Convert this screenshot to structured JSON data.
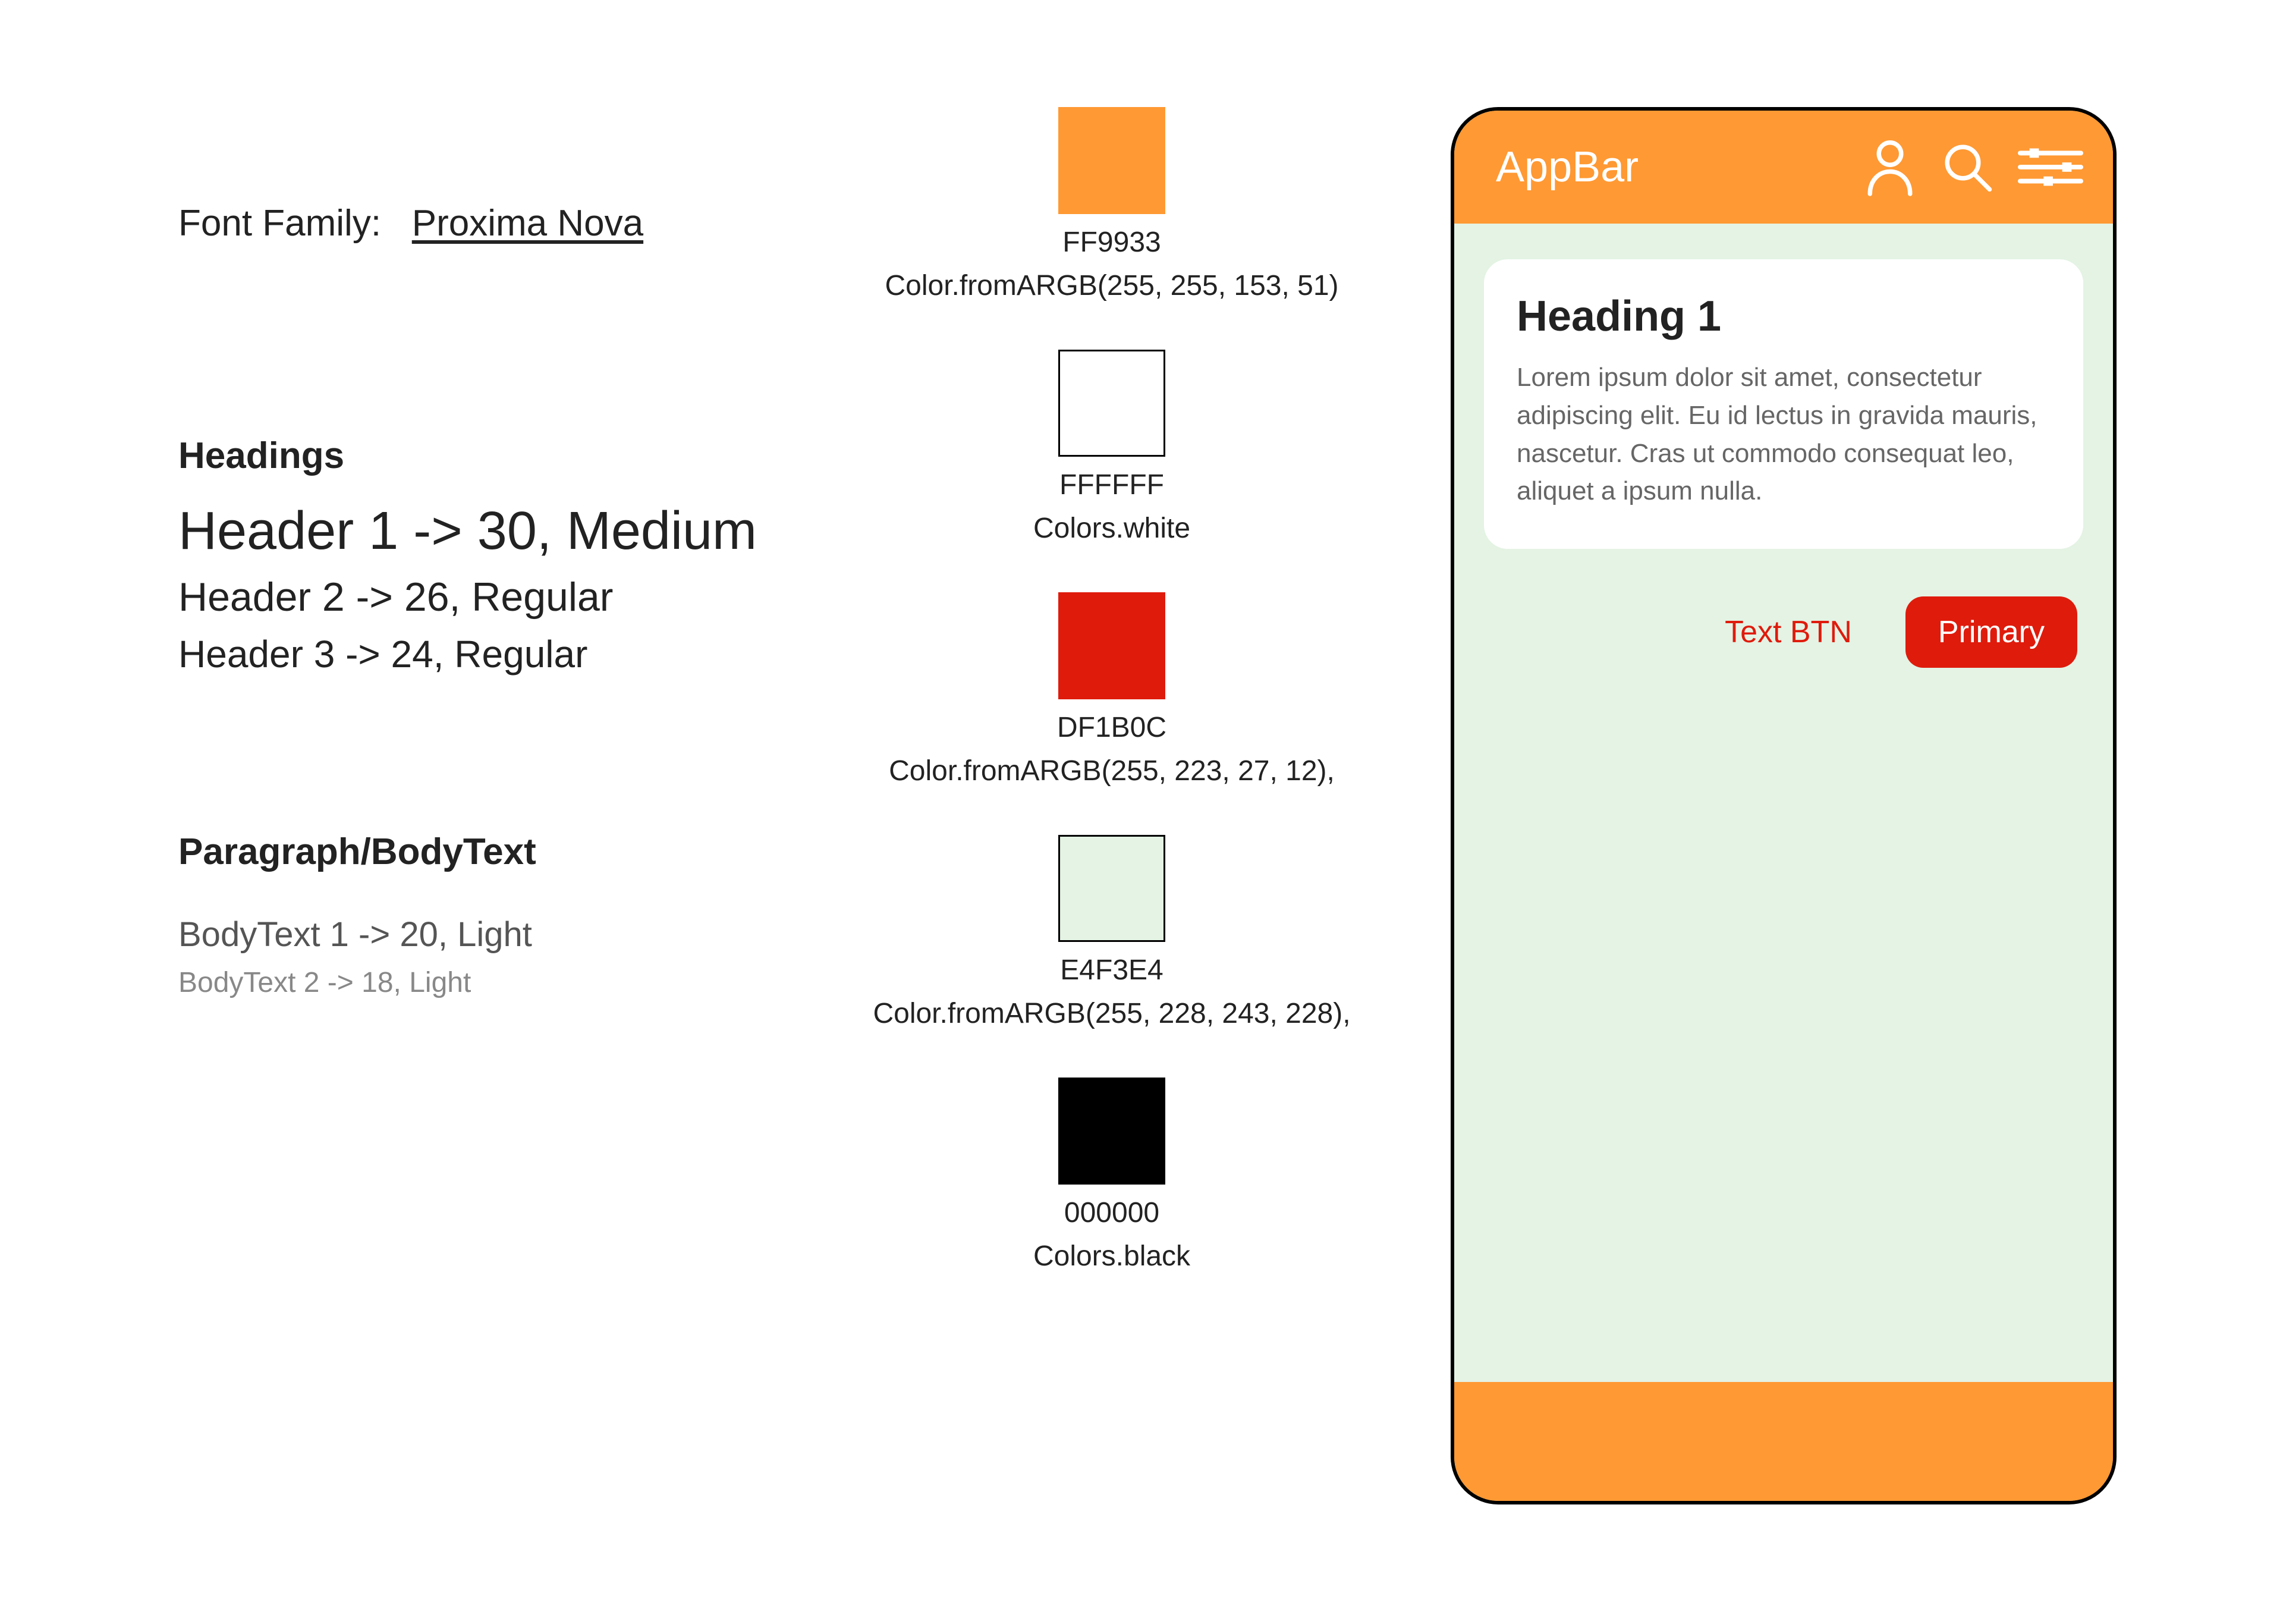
{
  "typography": {
    "font_family_label": "Font Family:",
    "font_family_value": "Proxima Nova",
    "headings_section_title": "Headings",
    "header1_spec": "Header 1 -> 30, Medium",
    "header2_spec": "Header 2 -> 26, Regular",
    "header3_spec": "Header 3 -> 24, Regular",
    "paragraph_section_title": "Paragraph/BodyText",
    "body1_spec": "BodyText 1 -> 20, Light",
    "body2_spec": "BodyText 2 -> 18, Light"
  },
  "colors": {
    "swatches": [
      {
        "hex": "FF9933",
        "label": "Color.fromARGB(255, 255, 153, 51)",
        "bg": "#FF9933",
        "bordered": false
      },
      {
        "hex": "FFFFFF",
        "label": "Colors.white",
        "bg": "#FFFFFF",
        "bordered": true
      },
      {
        "hex": "DF1B0C",
        "label": "Color.fromARGB(255, 223, 27, 12),",
        "bg": "#DF1B0C",
        "bordered": false
      },
      {
        "hex": "E4F3E4",
        "label": "Color.fromARGB(255, 228, 243, 228),",
        "bg": "#E4F3E4",
        "bordered": true
      },
      {
        "hex": "000000",
        "label": "Colors.black",
        "bg": "#000000",
        "bordered": false
      }
    ]
  },
  "phone": {
    "appbar_title": "AppBar",
    "icons": {
      "profile": "profile-icon",
      "search": "search-icon",
      "sliders": "sliders-icon"
    },
    "card": {
      "heading": "Heading 1",
      "body": "Lorem ipsum dolor sit amet, consectetur adipiscing elit. Eu id lectus in gravida mauris, nascetur. Cras ut commodo consequat leo, aliquet a ipsum nulla."
    },
    "buttons": {
      "text_btn": "Text BTN",
      "primary": "Primary"
    }
  }
}
